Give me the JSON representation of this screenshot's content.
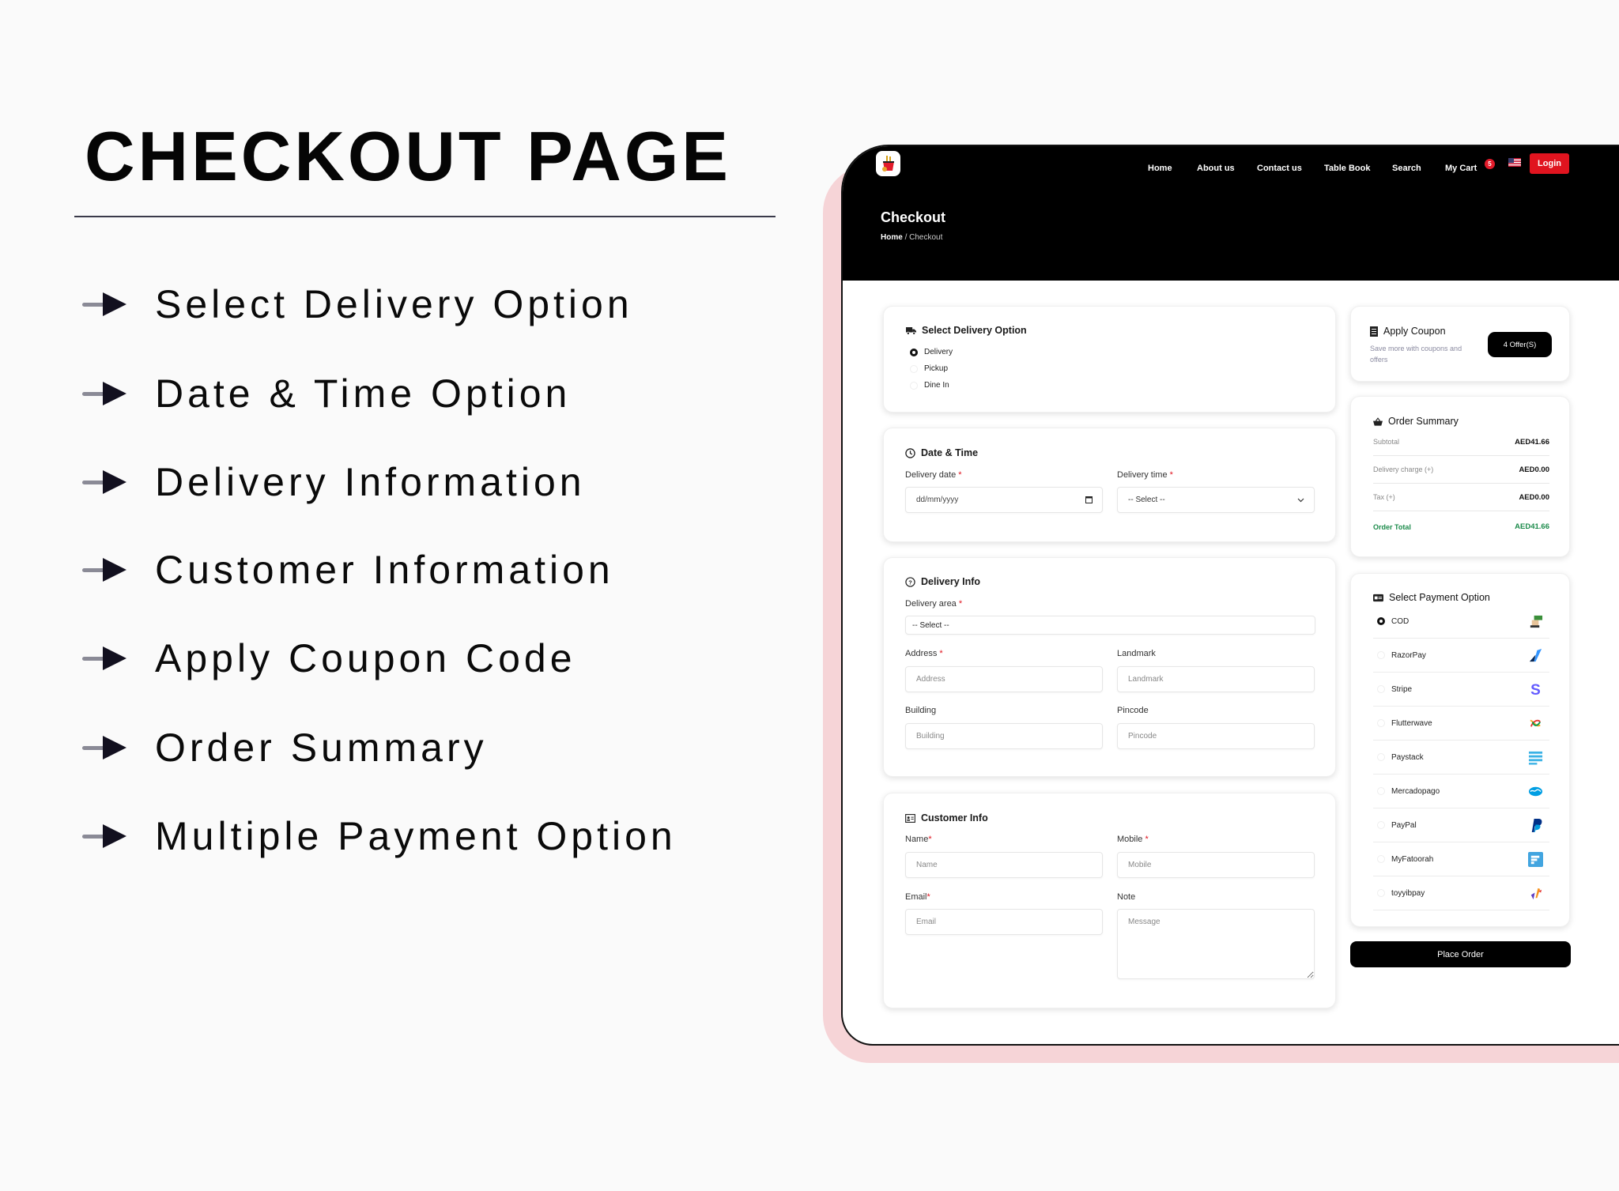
{
  "promo": {
    "title": "CHECKOUT PAGE",
    "features": [
      "Select Delivery Option",
      "Date & Time Option",
      "Delivery Information",
      "Customer Information",
      "Apply Coupon Code",
      "Order Summary",
      "Multiple Payment Option"
    ]
  },
  "nav": {
    "items": [
      "Home",
      "About us",
      "Contact us",
      "Table Book",
      "Search",
      "My Cart"
    ],
    "cart_count": "5",
    "login": "Login",
    "flag_icon": "us-flag-icon"
  },
  "page": {
    "title": "Checkout",
    "breadcrumb": {
      "home": "Home",
      "sep": "/",
      "current": "Checkout"
    }
  },
  "delivery_option": {
    "heading": "Select Delivery Option",
    "options": [
      "Delivery",
      "Pickup",
      "Dine In"
    ],
    "selected": "Delivery"
  },
  "date_time": {
    "heading": "Date & Time",
    "date_label": "Delivery date",
    "date_placeholder": "dd/mm/yyyy",
    "time_label": "Delivery time",
    "time_value": "-- Select --"
  },
  "delivery_info": {
    "heading": "Delivery Info",
    "area_label": "Delivery area",
    "area_value": "-- Select --",
    "address_label": "Address",
    "address_placeholder": "Address",
    "landmark_label": "Landmark",
    "landmark_placeholder": "Landmark",
    "building_label": "Building",
    "building_placeholder": "Building",
    "pincode_label": "Pincode",
    "pincode_placeholder": "Pincode"
  },
  "customer_info": {
    "heading": "Customer Info",
    "name_label": "Name",
    "name_placeholder": "Name",
    "mobile_label": "Mobile",
    "mobile_placeholder": "Mobile",
    "email_label": "Email",
    "email_placeholder": "Email",
    "note_label": "Note",
    "note_placeholder": "Message"
  },
  "required_mark": "*",
  "coupon": {
    "heading": "Apply Coupon",
    "subtitle": "Save more with coupons and offers",
    "button": "4 Offer(S)"
  },
  "summary": {
    "heading": "Order Summary",
    "rows": [
      {
        "label": "Subtotal",
        "value": "AED41.66"
      },
      {
        "label": "Delivery charge (+)",
        "value": "AED0.00"
      },
      {
        "label": "Tax (+)",
        "value": "AED0.00"
      }
    ],
    "total_label": "Order Total",
    "total_value": "AED41.66"
  },
  "payment": {
    "heading": "Select Payment Option",
    "options": [
      "COD",
      "RazorPay",
      "Stripe",
      "Flutterwave",
      "Paystack",
      "Mercadopago",
      "PayPal",
      "MyFatoorah",
      "toyyibpay"
    ],
    "selected": "COD"
  },
  "place_order": "Place Order",
  "colors": {
    "accent_red": "#e0141f",
    "total_green": "#1c8b4b",
    "pink_backdrop": "#f6d4d7",
    "header_black": "#000000"
  }
}
